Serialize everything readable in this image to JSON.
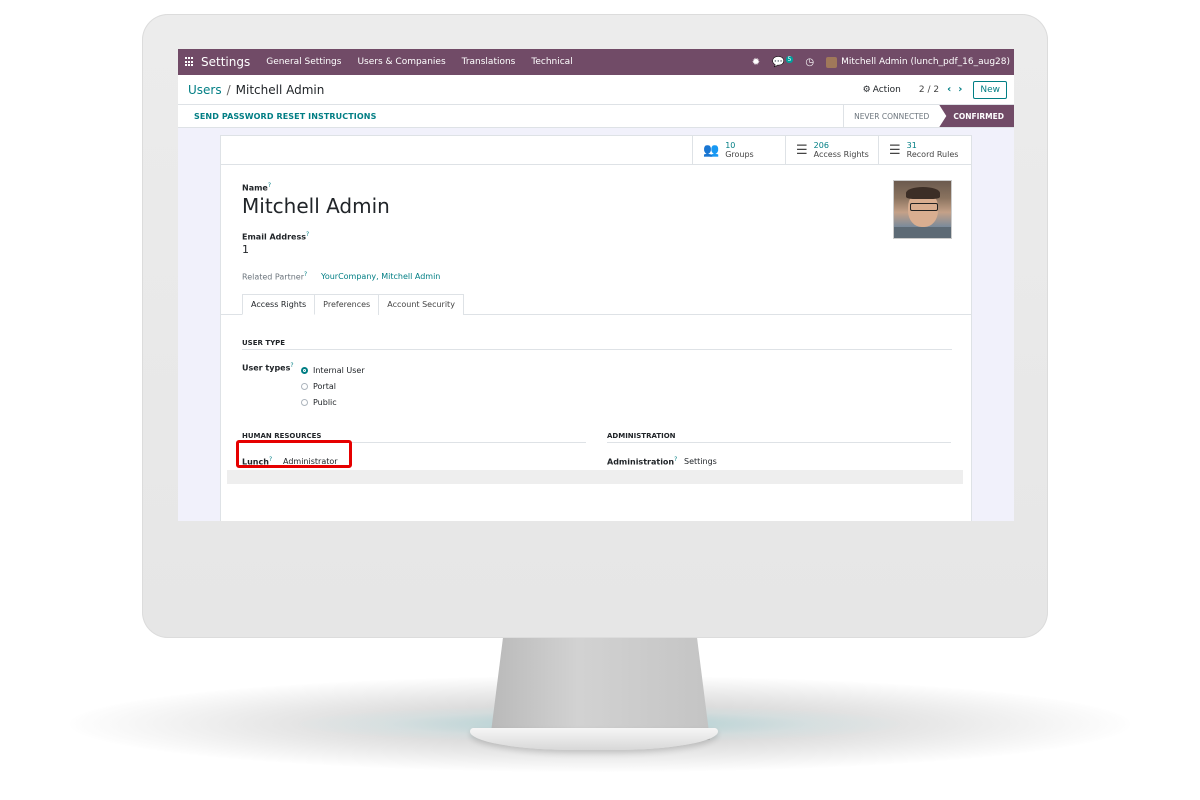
{
  "navbar": {
    "app_name": "Settings",
    "menu": [
      "General Settings",
      "Users & Companies",
      "Translations",
      "Technical"
    ],
    "chat_count": "5",
    "user": "Mitchell Admin (lunch_pdf_16_aug28)"
  },
  "breadcrumb": {
    "parent": "Users",
    "separator": "/",
    "current": "Mitchell Admin"
  },
  "control": {
    "action_label": "Action",
    "pager": "2 / 2",
    "new_label": "New"
  },
  "statusbar": {
    "reset_label": "SEND PASSWORD RESET INSTRUCTIONS",
    "stages": [
      "NEVER CONNECTED",
      "CONFIRMED"
    ],
    "active_stage": "CONFIRMED"
  },
  "stats": [
    {
      "value": "10",
      "label": "Groups",
      "icon": "users-icon"
    },
    {
      "value": "206",
      "label": "Access Rights",
      "icon": "list-icon"
    },
    {
      "value": "31",
      "label": "Record Rules",
      "icon": "list-icon"
    }
  ],
  "form": {
    "name_label": "Name",
    "name": "Mitchell Admin",
    "email_label": "Email Address",
    "email": "1",
    "partner_label": "Related Partner",
    "partner": "YourCompany, Mitchell Admin",
    "help_mark": "?"
  },
  "tabs": [
    "Access Rights",
    "Preferences",
    "Account Security"
  ],
  "user_type": {
    "section_title": "USER TYPE",
    "label": "User types",
    "options": [
      "Internal User",
      "Portal",
      "Public"
    ],
    "selected": "Internal User"
  },
  "hr": {
    "section_title": "HUMAN RESOURCES",
    "lunch_label": "Lunch",
    "lunch_value": "Administrator"
  },
  "admin": {
    "section_title": "ADMINISTRATION",
    "label": "Administration",
    "value": "Settings"
  },
  "colors": {
    "brand": "#714b67",
    "accent": "#017e84",
    "highlight": "#e60000"
  }
}
